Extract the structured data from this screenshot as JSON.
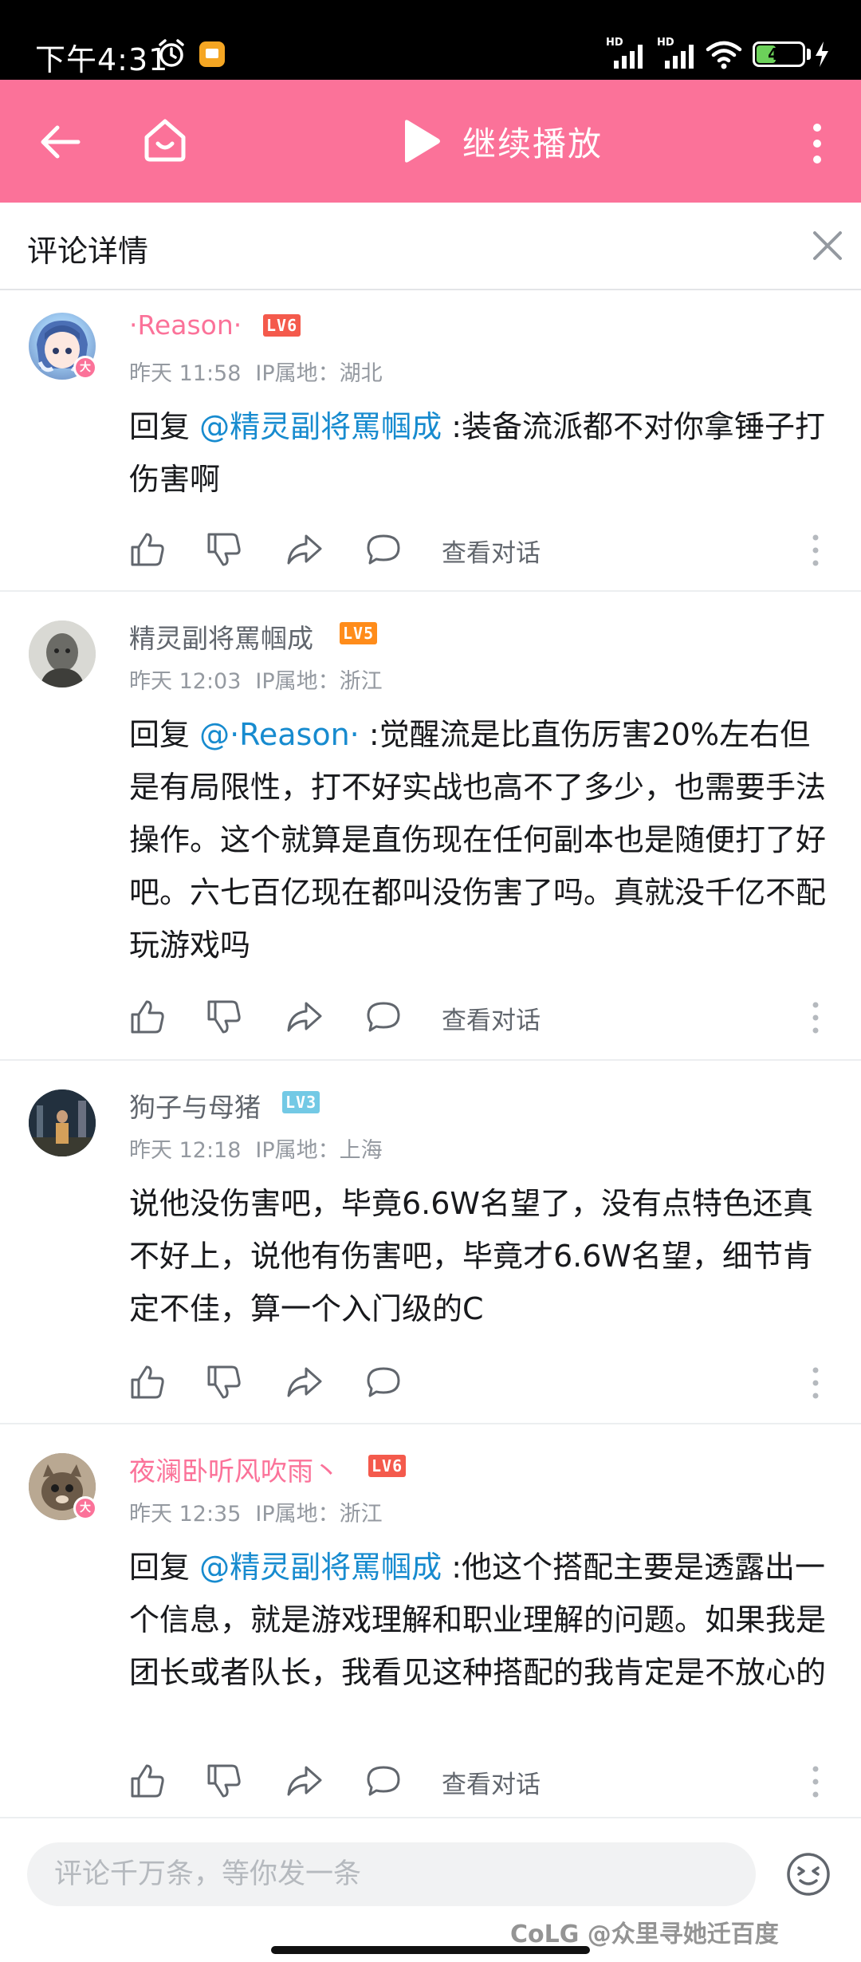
{
  "status_bar": {
    "time": "下午4:31",
    "signal_label": "HD",
    "battery_level": 47,
    "battery_text": "47"
  },
  "app_bar": {
    "continue_label": "继续播放"
  },
  "detail_header": {
    "title": "评论详情"
  },
  "comments": [
    {
      "username": "·Reason·",
      "level": "LV6",
      "level_color": "#f45a4c",
      "vip": true,
      "badge": "大",
      "time": "昨天 11:58",
      "ip": "IP属地：湖北",
      "reply_prefix": "回复 ",
      "mention": "@精灵副将罵帼成",
      "text": " :装备流派都不对你拿锤子打伤害啊",
      "view_conversation": "查看对话"
    },
    {
      "username": "精灵副将罵帼成",
      "level": "LV5",
      "level_color": "#ff8c1a",
      "vip": false,
      "badge": "",
      "time": "昨天 12:03",
      "ip": "IP属地：浙江",
      "reply_prefix": "回复 ",
      "mention": "@·Reason·",
      "text": " :觉醒流是比直伤厉害20%左右但是有局限性，打不好实战也高不了多少，也需要手法操作。这个就算是直伤现在任何副本也是随便打了好吧。六七百亿现在都叫没伤害了吗。真就没千亿不配玩游戏吗",
      "view_conversation": "查看对话"
    },
    {
      "username": "狗子与母猪",
      "level": "LV3",
      "level_color": "#73c9e5",
      "vip": false,
      "badge": "",
      "time": "昨天 12:18",
      "ip": "IP属地：上海",
      "reply_prefix": "",
      "mention": "",
      "text": "说他没伤害吧，毕竟6.6W名望了，没有点特色还真不好上，说他有伤害吧，毕竟才6.6W名望，细节肯定不佳，算一个入门级的C",
      "view_conversation": ""
    },
    {
      "username": "夜澜卧听风吹雨丶",
      "level": "LV6",
      "level_color": "#f45a4c",
      "vip": true,
      "badge": "大",
      "time": "昨天 12:35",
      "ip": "IP属地：浙江",
      "reply_prefix": "回复 ",
      "mention": "@精灵副将罵帼成",
      "text": " :他这个搭配主要是透露出一个信息，就是游戏理解和职业理解的问题。如果我是团长或者队长，我看见这种搭配的我肯定是不放心的",
      "view_conversation": "查看对话"
    }
  ],
  "bottom_bar": {
    "input_placeholder": "评论千万条，等你发一条",
    "watermark": "CoLG @众里寻她迁百度"
  },
  "colors": {
    "brand_pink": "#fb7299",
    "mention_blue": "#178bcf",
    "meta_gray": "#9499a0"
  }
}
